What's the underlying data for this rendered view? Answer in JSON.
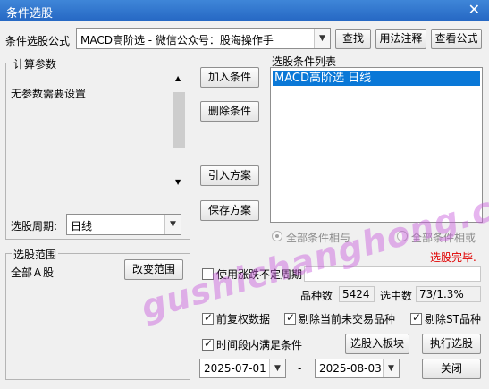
{
  "window": {
    "title": "条件选股",
    "close_glyph": "✕"
  },
  "formula": {
    "label": "条件选股公式",
    "value": "MACD高阶选  -  微信公众号：股海操作手",
    "find_label": "查找",
    "usage_label": "用法注释",
    "view_label": "查看公式"
  },
  "params": {
    "legend": "计算参数",
    "empty_text": "无参数需要设置",
    "period_label": "选股周期:",
    "period_value": "日线"
  },
  "actions": {
    "add": "加入条件",
    "remove": "删除条件",
    "import": "引入方案",
    "save": "保存方案"
  },
  "conditions": {
    "legend": "选股条件列表",
    "items": [
      "MACD高阶选  日线"
    ],
    "all_and": "全部条件相与",
    "all_or": "全部条件相或",
    "status": "选股完毕."
  },
  "range": {
    "legend": "选股范围",
    "value": "全部Ａ股",
    "change_label": "改变范围"
  },
  "options": {
    "use_period_label": "使用涨跌不定周期",
    "count_label": "品种数",
    "count_value": "5424",
    "selected_label": "选中数",
    "selected_value": "73/1.3%",
    "pre_adjust_label": "前复权数据",
    "exclude_untraded_label": "剔除当前未交易品种",
    "exclude_st_label": "剔除ST品种",
    "time_range_label": "时间段内满足条件",
    "to_block_label": "选股入板块",
    "execute_label": "执行选股",
    "date_from": "2025-07-01",
    "date_sep": "-",
    "date_to": "2025-08-03",
    "close_label": "关闭"
  },
  "watermark": "gushichanghong.com",
  "colors": {
    "title_bar": "#2d6fc9",
    "selected_row": "#0a78d7",
    "status": "#e00000",
    "watermark": "#c85adc"
  }
}
